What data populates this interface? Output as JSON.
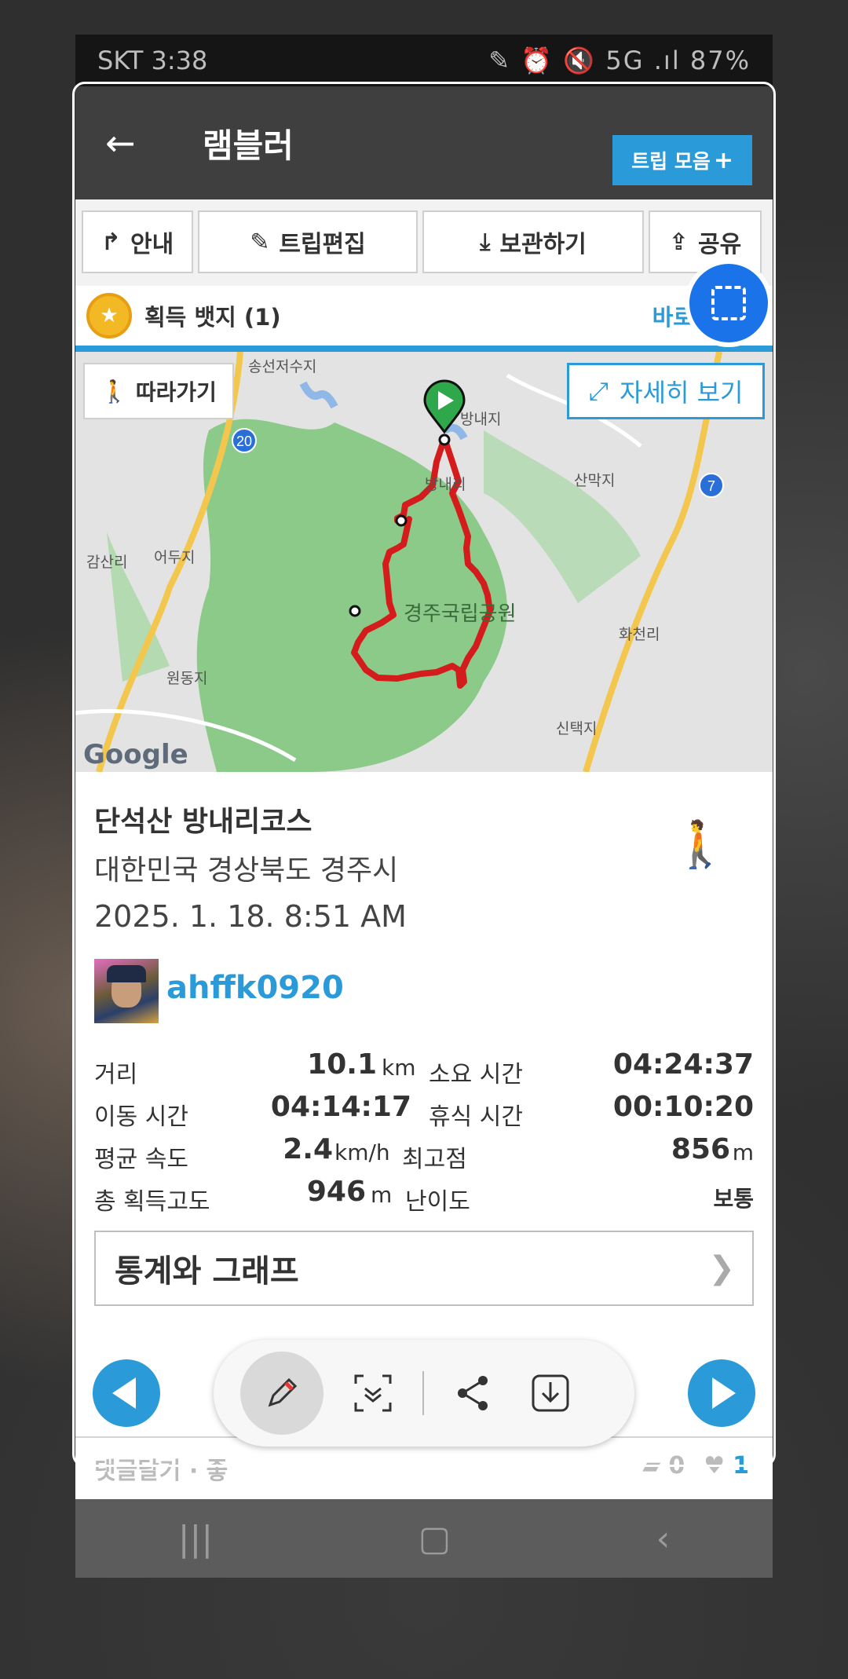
{
  "status_bar": {
    "left": "SKT 3:38",
    "right": "87%"
  },
  "app_bar": {
    "title": "램블러",
    "trip_collection": "트립 모음"
  },
  "toolbar": {
    "guide": "안내",
    "edit_trip": "트립편집",
    "save": "보관하기",
    "share": "공유"
  },
  "badge": {
    "label": "획득 뱃지 (1)",
    "go": "바로"
  },
  "map": {
    "follow": "따라가기",
    "detail": "자세히 보기",
    "places": [
      "송선저수지",
      "방내지",
      "방내리",
      "산막지",
      "감산리",
      "어두지",
      "경주국립공원",
      "화천리",
      "원동지",
      "신택지"
    ],
    "road_numbers": [
      "20",
      "7"
    ],
    "provider": "Google"
  },
  "trip": {
    "name": "단석산 방내리코스",
    "location": "대한민국 경상북도 경주시",
    "datetime": "2025. 1. 18. 8:51 AM",
    "user": "ahffk0920",
    "activity_icon": "hiker-icon"
  },
  "stats": [
    {
      "label": "거리",
      "value": "10.1",
      "unit": "km",
      "label2": "소요 시간",
      "value2": "04:24:37",
      "unit2": ""
    },
    {
      "label": "이동 시간",
      "value": "04:14:17",
      "unit": "",
      "label2": "휴식 시간",
      "value2": "00:10:20",
      "unit2": ""
    },
    {
      "label": "평균 속도",
      "value": "2.4",
      "unit": "km/h",
      "label2": "최고점",
      "value2": "856",
      "unit2": "m"
    },
    {
      "label": "총 획득고도",
      "value": "946",
      "unit": "m",
      "label2": "난이도",
      "value2": "보통",
      "unit2": ""
    }
  ],
  "graph_button": "통계와 그래프",
  "comment_bar": {
    "label": "댓글달기 · 좋",
    "comments": "0",
    "likes": "1"
  },
  "colors": {
    "accent": "#2a9ad8",
    "route": "#d41c1c",
    "park": "#7cc57a"
  }
}
